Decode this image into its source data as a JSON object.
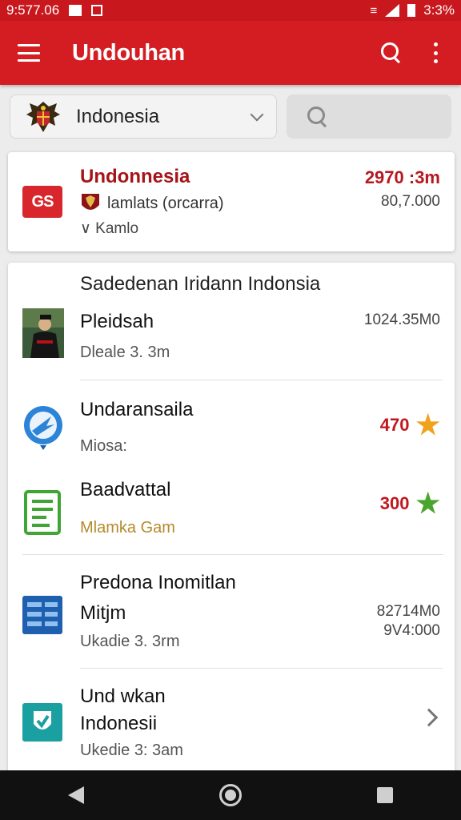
{
  "status_bar": {
    "time": "9:577.06",
    "battery": "3:3%"
  },
  "app_bar": {
    "title": "Undouhan"
  },
  "filter": {
    "country": "Indonesia",
    "search_placeholder": ""
  },
  "featured": {
    "icon_text": "GS",
    "title": "Undonnesia",
    "subtitle": "lamlats (orcarra)",
    "check_label": "∨ Kamlo",
    "size": "2970 :3m",
    "count": "80,7.000"
  },
  "list": {
    "section_title": "Sadedenan Iridann Indonsia",
    "items": [
      {
        "title": "Pleidsah",
        "subtitle": "Dleale 3. 3m",
        "right_top": "1024.35M0",
        "icon": "portrait-photo-icon"
      },
      {
        "title": "Undaransaila",
        "subtitle": "Miosa:",
        "rating": "470",
        "icon": "blue-bird-icon",
        "star_color": "#f0a21c"
      },
      {
        "title": "Baadvattal",
        "subtitle": "Mlamka Gam",
        "rating": "300",
        "icon": "green-document-icon",
        "star_color": "#4aa52e",
        "subtitle_color": "#b58a2a"
      },
      {
        "title": "Predona Inomitlan",
        "title2": "Mitjm",
        "subtitle": "Ukadie 3. 3rm",
        "right_top": "82714M0",
        "right_bottom": "9V4:000",
        "icon": "blue-grid-icon"
      },
      {
        "title": "Und wkan",
        "title2": "Indonesii",
        "subtitle": "Ukedie 3: 3am",
        "icon": "teal-shield-icon"
      }
    ]
  },
  "colors": {
    "brand_red": "#d41d23",
    "title_red": "#a51419"
  }
}
